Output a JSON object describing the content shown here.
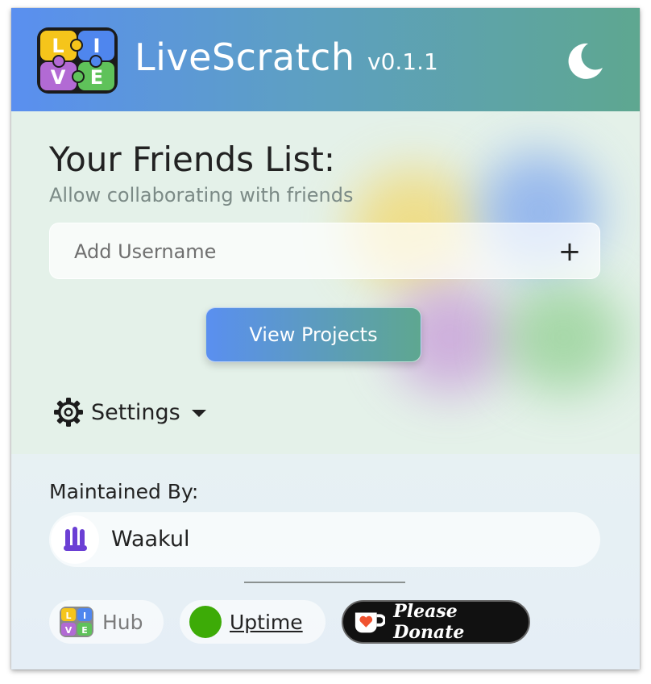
{
  "header": {
    "app_title": "LiveScratch",
    "version": "v0.1.1",
    "logo_letters": [
      "L",
      "I",
      "V",
      "E"
    ],
    "theme_icon": "moon-icon"
  },
  "friends": {
    "title": "Your Friends List:",
    "subtitle": "Allow collaborating with friends",
    "add_placeholder": "Add Username",
    "add_button_icon": "+",
    "view_projects_label": "View Projects",
    "settings_label": "Settings"
  },
  "footer": {
    "maintained_by_label": "Maintained By:",
    "maintainer_name": "Waakul",
    "hub_label": "Hub",
    "uptime_label": "Uptime",
    "donate_label": "Please Donate"
  },
  "colors": {
    "header_gradient_start": "#5a8ff0",
    "header_gradient_end": "#5ea790",
    "uptime_status": "#3dab07",
    "puzzle_yellow": "#f5c51b",
    "puzzle_blue": "#4f86ee",
    "puzzle_purple": "#b26ad4",
    "puzzle_green": "#5fc25a"
  }
}
